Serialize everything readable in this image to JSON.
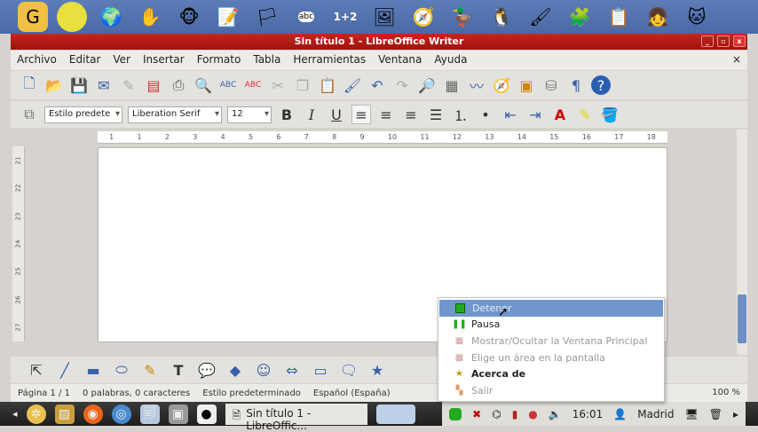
{
  "dock": {
    "icons": [
      "gcompris-icon",
      "tuxpaint-ball-icon",
      "globe-icon",
      "hand-icon",
      "monkey-icon",
      "notepad-icon",
      "flag-icon",
      "tux-abc-icon",
      "math-1plus2-icon",
      "picture-icon",
      "compass-icon",
      "duck-lamp-icon",
      "tux-icon",
      "paint-icon",
      "puzzle-icon",
      "clipboard-icon",
      "girl-icon",
      "scratch-cat-icon"
    ],
    "math_label": "1+2",
    "abc_label": "abc"
  },
  "window": {
    "title": "Sin título 1 - LibreOffice Writer"
  },
  "menu": [
    "Archivo",
    "Editar",
    "Ver",
    "Insertar",
    "Formato",
    "Tabla",
    "Herramientas",
    "Ventana",
    "Ayuda"
  ],
  "menu_close": "×",
  "toolbar2": {
    "style": "Estilo predete",
    "font": "Liberation Serif",
    "size": "12",
    "bold": "B",
    "italic": "I",
    "underline": "U"
  },
  "ruler": [
    "1",
    "1",
    "2",
    "3",
    "4",
    "5",
    "6",
    "7",
    "8",
    "9",
    "10",
    "11",
    "12",
    "13",
    "14",
    "15",
    "16",
    "17",
    "18"
  ],
  "vruler": [
    "21",
    "22",
    "23",
    "24",
    "25",
    "26",
    "27"
  ],
  "status": {
    "page": "Página 1 / 1",
    "words": "0 palabras, 0 caracteres",
    "style": "Estilo predeterminado",
    "language": "Español (España)",
    "zoom": "100 %"
  },
  "context_menu": [
    {
      "label": "Detener",
      "icon": "green-stop-icon",
      "state": "highlighted"
    },
    {
      "label": "Pausa",
      "icon": "pause-icon",
      "state": "enabled"
    },
    {
      "label": "Mostrar/Ocultar la Ventana Principal",
      "icon": "recorder-icon",
      "state": "disabled"
    },
    {
      "label": "Elige un área en la pantalla",
      "icon": "recorder-icon",
      "state": "disabled"
    },
    {
      "label": "Acerca de",
      "icon": "star-icon",
      "state": "enabled"
    },
    {
      "label": "Salir",
      "icon": "exit-icon",
      "state": "disabled"
    }
  ],
  "taskbar": {
    "window_label": "Sin título 1 - LibreOffic...",
    "clock": "16:01",
    "location": "Madrid"
  }
}
